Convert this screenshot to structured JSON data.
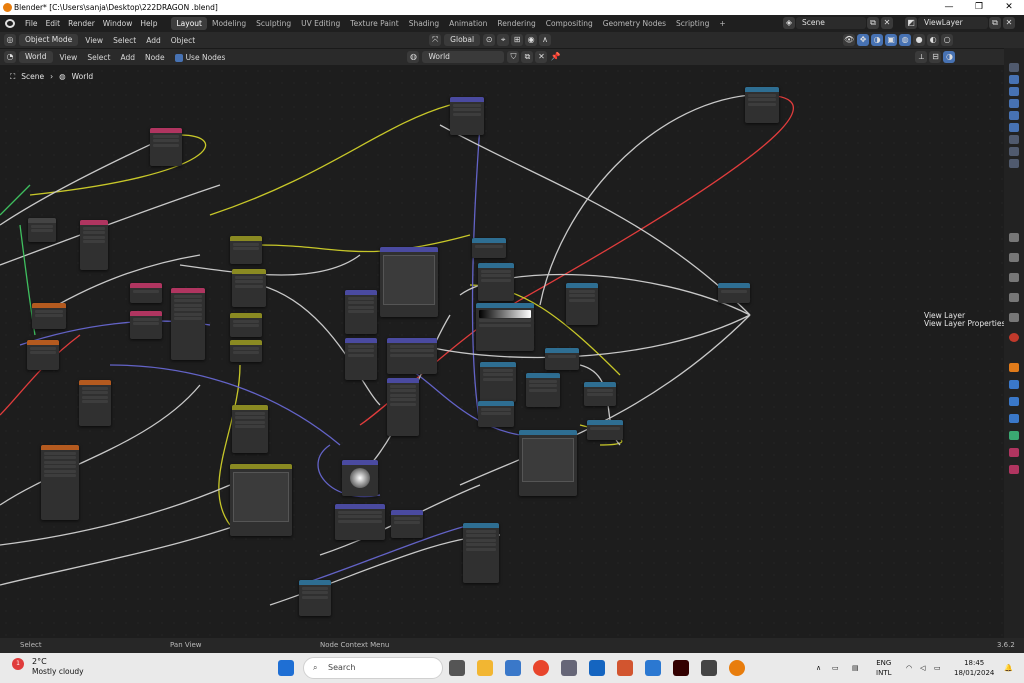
{
  "window": {
    "title": "Blender* [C:\\Users\\sanja\\Desktop\\222DRAGON .blend]",
    "minimize": "—",
    "maximize": "❐",
    "close": "✕"
  },
  "menu": {
    "items": [
      "File",
      "Edit",
      "Render",
      "Window",
      "Help"
    ]
  },
  "workspaces": {
    "tabs": [
      "Layout",
      "Modeling",
      "Sculpting",
      "UV Editing",
      "Texture Paint",
      "Shading",
      "Animation",
      "Rendering",
      "Compositing",
      "Geometry Nodes",
      "Scripting"
    ],
    "active": "Layout",
    "add": "+"
  },
  "scene": {
    "name": "Scene",
    "view_layer": "ViewLayer"
  },
  "header1": {
    "mode": "Object Mode",
    "view": "View",
    "select": "Select",
    "add": "Add",
    "object": "Object",
    "orientation": "Global"
  },
  "header2": {
    "shader_type": "World",
    "view": "View",
    "select": "Select",
    "add": "Add",
    "node": "Node",
    "use_nodes": "Use Nodes",
    "world_name": "World"
  },
  "breadcrumb": {
    "scene": "Scene",
    "world": "World"
  },
  "sidebar_tooltip": {
    "line1": "View Layer",
    "line2": "View Layer Properties"
  },
  "status": {
    "select": "Select",
    "pan": "Pan View",
    "context": "Node Context Menu",
    "version": "3.6.2"
  },
  "taskbar": {
    "temp": "2°C",
    "weather": "Mostly cloudy",
    "search": "Search",
    "lang1": "ENG",
    "lang2": "INTL",
    "time": "18:45",
    "date": "18/01/2024",
    "badge": "1"
  },
  "colors": {
    "accent": "#4772b3",
    "header_bg": "#2a2a2a",
    "canvas_bg": "#1d1d1d",
    "red_link": "#e03c3c",
    "yellow_link": "#c7c729",
    "purple_link": "#6363c7",
    "white_link": "#c8c8c8"
  }
}
